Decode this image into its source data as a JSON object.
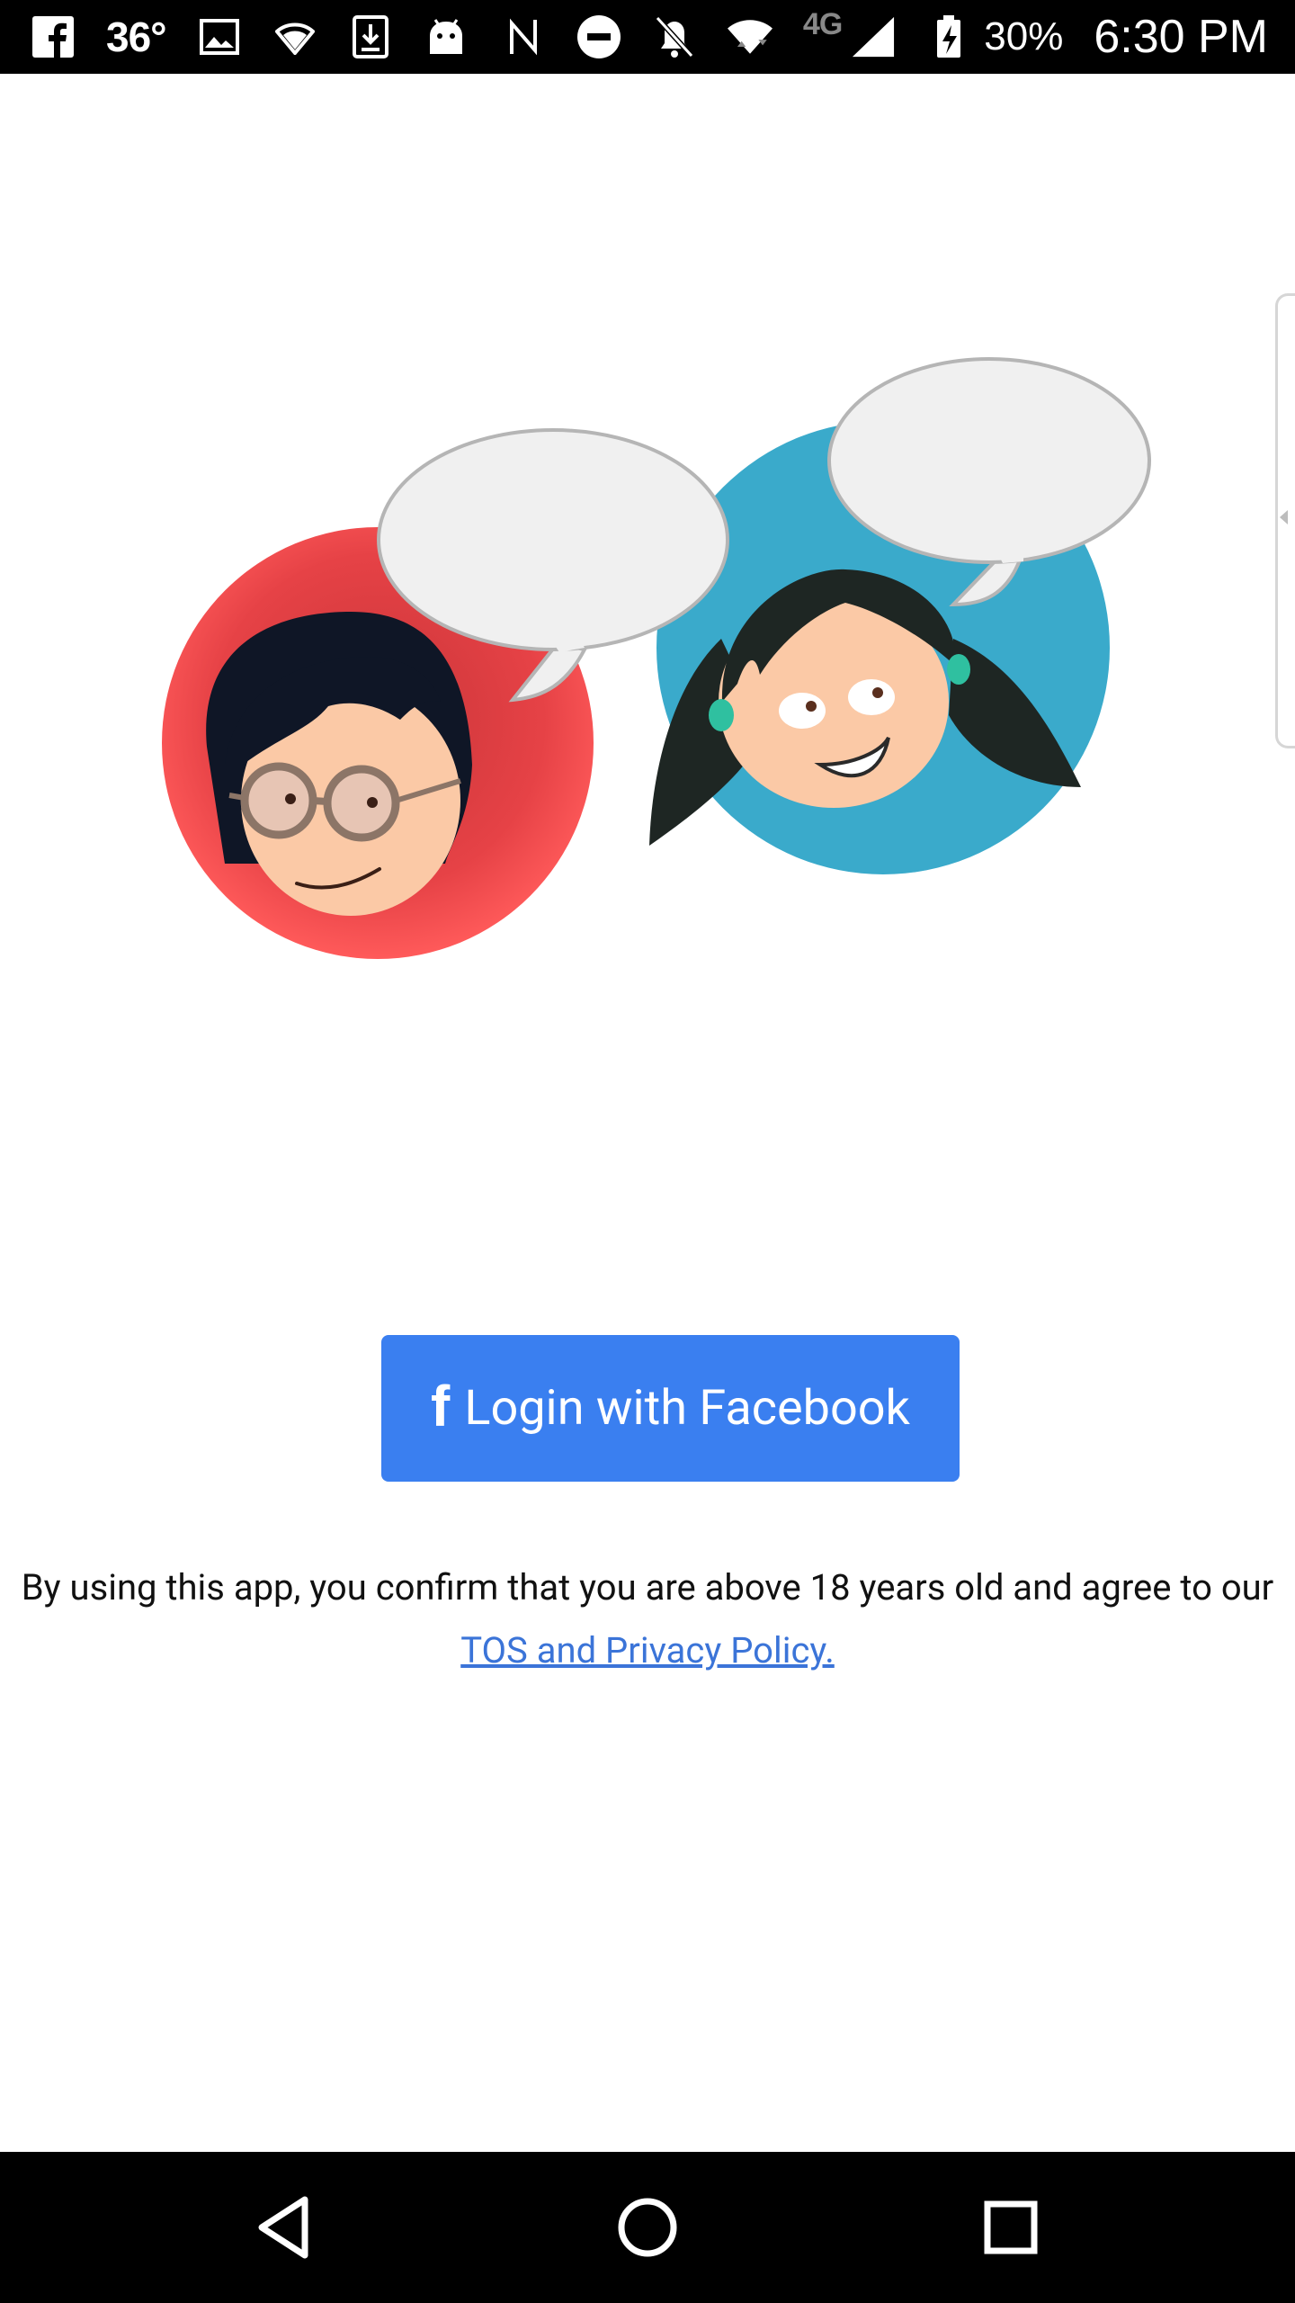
{
  "status_bar": {
    "temperature": "36°",
    "network_type": "4G",
    "battery_percent": "30%",
    "time": "6:30 PM",
    "icons_left": [
      "facebook-icon",
      "image-icon",
      "wifi-lock-icon",
      "download-icon",
      "android-icon"
    ],
    "icons_right": [
      "nfc-icon",
      "do-not-disturb-icon",
      "notifications-off-icon",
      "wifi-icon",
      "signal-icon",
      "battery-charging-icon"
    ]
  },
  "illustration": {
    "characters": [
      "boy-avatar",
      "girl-avatar"
    ],
    "colors": {
      "boy_circle": "#f0494d",
      "girl_circle": "#3aaacb",
      "speech_bubble": "#f0f0f0"
    }
  },
  "login": {
    "button_icon": "f",
    "button_label": "Login with Facebook",
    "button_color": "#3a7ff0"
  },
  "disclaimer": {
    "text": "By using this app, you confirm that you are above 18 years old and agree to our",
    "link_text": "TOS and Privacy Policy."
  },
  "nav_bar": {
    "buttons": [
      "back-icon",
      "home-icon",
      "recents-icon"
    ]
  }
}
